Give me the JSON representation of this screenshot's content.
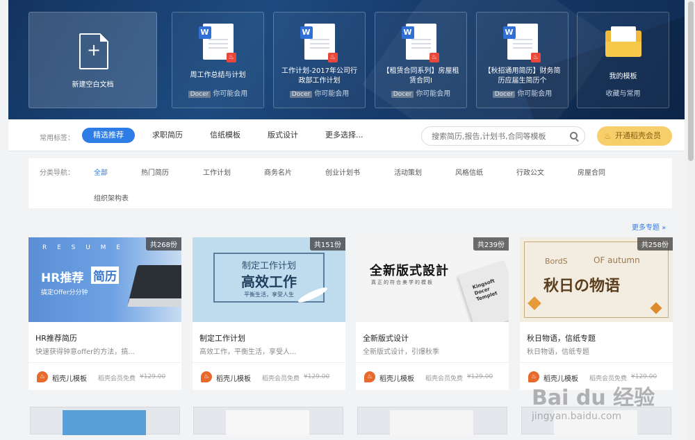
{
  "banner": {
    "tiles": [
      {
        "title": "新建空白文档"
      },
      {
        "title": "周工作总结与计划",
        "tag": "Docer",
        "sub": "你可能会用"
      },
      {
        "title": "工作计划-2017年公司行政部工作计划",
        "tag": "Docer",
        "sub": "你可能会用"
      },
      {
        "title": "【租赁合同系列】房屋租赁合同I",
        "tag": "Docer",
        "sub": "你可能会用"
      },
      {
        "title": "【秋招通用简历】财务简历应届生简历个",
        "tag": "Docer",
        "sub": "你可能会用"
      },
      {
        "title": "我的模板",
        "sub": "收藏与常用"
      }
    ]
  },
  "nav": {
    "label": "常用标签：",
    "tabs": [
      "精选推荐",
      "求职简历",
      "信纸模板",
      "版式设计",
      "更多选择..."
    ],
    "search_placeholder": "搜索简历,报告,计划书,合同等模板",
    "vip_label": "开通稻壳会员"
  },
  "categories": {
    "label": "分类导航：",
    "items": [
      "全部",
      "热门简历",
      "工作计划",
      "商务名片",
      "创业计划书",
      "活动策划",
      "风格信纸",
      "行政公文",
      "房屋合同",
      "组织架构表"
    ]
  },
  "more_topics": "更多专题 »",
  "cards": [
    {
      "count": "共268份",
      "title": "HR推荐简历",
      "desc": "快速获得钟意offer的方法，搞...",
      "author": "稻壳儿模板",
      "vip": "稻壳会员免费",
      "price": "¥129.00",
      "thumb_text": [
        "R E S U M E",
        "HR推荐",
        "简历",
        "搞定Offer分分钟"
      ]
    },
    {
      "count": "共151份",
      "title": "制定工作计划",
      "desc": "高效工作，平衡生活，享受人...",
      "author": "稻壳儿模板",
      "vip": "稻壳会员免费",
      "price": "¥129.00",
      "thumb_text": [
        "制定工作计划",
        "高效工作",
        "平衡生活，享受人生"
      ]
    },
    {
      "count": "共239份",
      "title": "全新版式设计",
      "desc": "全新版式设计，引爆秋季",
      "author": "稻壳儿模板",
      "vip": "稻壳会员免费",
      "price": "¥129.00",
      "thumb_text": [
        "全新版式設計",
        "真正的符合美学的模板",
        "Kingsoft Docer Templet"
      ]
    },
    {
      "count": "共258份",
      "title": "秋日物语，信纸专题",
      "desc": "秋日物语，信纸专题",
      "author": "稻壳儿模板",
      "vip": "稻壳会员免费",
      "price": "¥129.00",
      "thumb_text": [
        "BordS",
        "OF autumn",
        "秋日の物语"
      ]
    }
  ],
  "watermark": {
    "main": "Bai du 经验",
    "sub": "jingyan.baidu.com"
  },
  "colors": {
    "accent": "#2e7ce6",
    "vip": "#f6cf6a",
    "banner": "#1d4b80"
  }
}
